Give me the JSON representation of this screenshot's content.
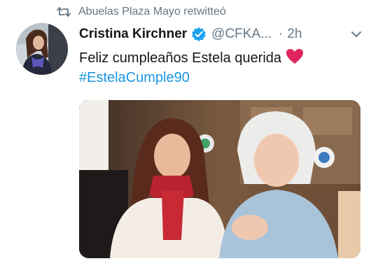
{
  "retweet": {
    "icon": "retweet-icon",
    "text": "Abuelas Plaza Mayo retwitteó"
  },
  "tweet": {
    "display_name": "Cristina Kirchner",
    "verified_icon": "verified-badge-icon",
    "handle": "@CFKA...",
    "separator": "·",
    "time": "2h",
    "menu_icon": "chevron-down-icon",
    "text": "Feliz cumpleaños Estela querida",
    "emoji": "red-heart-icon",
    "hashtag": "#EstelaCumple90",
    "media": "photo-two-women-smiling"
  },
  "colors": {
    "link": "#1b95e0",
    "secondary_text": "#657786",
    "primary_text": "#14171a",
    "heart": "#e0245e",
    "verified": "#1da1f2"
  }
}
